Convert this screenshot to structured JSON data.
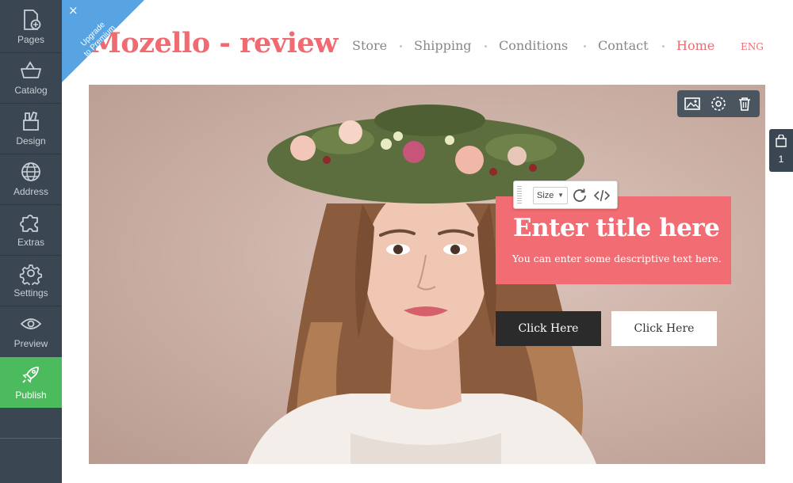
{
  "sidebar": {
    "items": [
      {
        "key": "pages",
        "label": "Pages",
        "icon": "page-add-icon"
      },
      {
        "key": "catalog",
        "label": "Catalog",
        "icon": "basket-icon"
      },
      {
        "key": "design",
        "label": "Design",
        "icon": "design-tools-icon"
      },
      {
        "key": "address",
        "label": "Address",
        "icon": "globe-icon"
      },
      {
        "key": "extras",
        "label": "Extras",
        "icon": "puzzle-icon"
      },
      {
        "key": "settings",
        "label": "Settings",
        "icon": "gear-icon"
      },
      {
        "key": "preview",
        "label": "Preview",
        "icon": "eye-icon"
      },
      {
        "key": "publish",
        "label": "Publish",
        "icon": "rocket-icon"
      }
    ]
  },
  "ribbon": {
    "line1": "Upgrade",
    "line2": "to Premium",
    "color": "#58a4e3"
  },
  "site": {
    "title": "Mozello - review",
    "nav": [
      "Store",
      "Shipping",
      "Conditions",
      "Contact",
      "Home"
    ],
    "active_nav": "Home",
    "language": "ENG"
  },
  "hero": {
    "title": "Enter title here",
    "subtitle": "You can enter some descriptive text here.",
    "button_primary": "Click Here",
    "button_secondary": "Click Here",
    "image_subject": "woman wearing a flower crown"
  },
  "text_toolbar": {
    "size_label": "Size",
    "icons": [
      "refresh-icon",
      "code-icon"
    ]
  },
  "image_toolbar": {
    "icons": [
      "image-icon",
      "gear-icon",
      "trash-icon"
    ]
  },
  "cart": {
    "count": "1"
  },
  "colors": {
    "accent": "#f06a71",
    "sidebar": "#3a4651",
    "publish": "#4cbb5e",
    "text_box": "#f26d73",
    "dark_button": "#2b2b2b"
  }
}
